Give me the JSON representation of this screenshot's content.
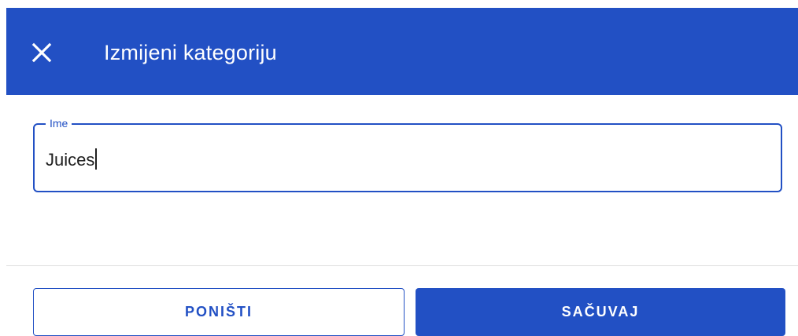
{
  "dialog": {
    "title": "Izmijeni kategoriju",
    "close_icon": "close-icon"
  },
  "form": {
    "name_label": "Ime",
    "name_value": "Juices"
  },
  "actions": {
    "cancel_label": "PONIŠTI",
    "save_label": "SAČUVAJ"
  },
  "colors": {
    "primary": "#2250c4",
    "text": "#1f1f1f",
    "divider": "#dedede"
  }
}
